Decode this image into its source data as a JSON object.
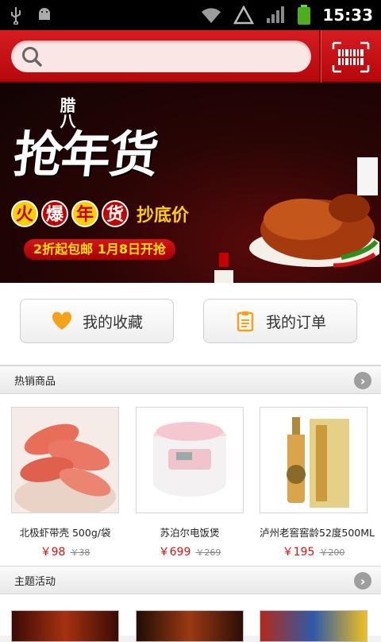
{
  "status": {
    "time": "15:33"
  },
  "search": {
    "placeholder": ""
  },
  "banner": {
    "small_text": "腊八",
    "title": "抢年货",
    "tag_chars": [
      "火",
      "爆",
      "年",
      "货"
    ],
    "tag_tail": "抄底价",
    "promo": "2折起包邮 1月8日开抢",
    "slides": 5,
    "active_slide": 1
  },
  "actions": {
    "favorites_label": "我的收藏",
    "orders_label": "我的订单"
  },
  "hot": {
    "title": "热销商品",
    "items": [
      {
        "name": "北极虾带壳 500g/袋",
        "price": "￥98",
        "old_price": "￥38"
      },
      {
        "name": "苏泊尔电饭煲",
        "price": "￥699",
        "old_price": "￥269"
      },
      {
        "name": "泸州老窖窖龄52度500ML",
        "price": "￥195",
        "old_price": "￥200"
      }
    ]
  },
  "theme": {
    "title": "主题活动"
  },
  "colors": {
    "brand_red": "#c8101a",
    "price_red": "#e01010",
    "accent_yellow": "#ffd000"
  }
}
